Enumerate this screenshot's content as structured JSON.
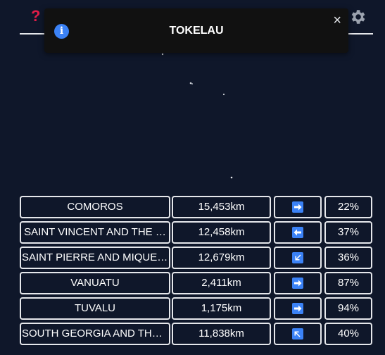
{
  "header": {
    "help_icon": "question-mark-icon",
    "settings_icon": "gear-icon"
  },
  "toast": {
    "icon": "info-icon",
    "title": "TOKELAU",
    "close_label": "×"
  },
  "guesses": [
    {
      "country": "COMOROS",
      "distance": "15,453km",
      "direction": "E",
      "direction_icon": "arrow-right-icon",
      "proximity": "22%"
    },
    {
      "country": "SAINT VINCENT AND THE …",
      "distance": "12,458km",
      "direction": "W",
      "direction_icon": "arrow-left-icon",
      "proximity": "37%"
    },
    {
      "country": "SAINT PIERRE AND MIQUEL…",
      "distance": "12,679km",
      "direction": "SW",
      "direction_icon": "arrow-down-left-icon",
      "proximity": "36%"
    },
    {
      "country": "VANUATU",
      "distance": "2,411km",
      "direction": "E",
      "direction_icon": "arrow-right-icon",
      "proximity": "87%"
    },
    {
      "country": "TUVALU",
      "distance": "1,175km",
      "direction": "E",
      "direction_icon": "arrow-right-icon",
      "proximity": "94%"
    },
    {
      "country": "SOUTH GEORGIA AND THE …",
      "distance": "11,838km",
      "direction": "NW",
      "direction_icon": "arrow-up-left-icon",
      "proximity": "40%"
    }
  ],
  "colors": {
    "background": "#0f172a",
    "help_icon": "#e11d48",
    "arrow_tile": "#3b82f6",
    "toast_bg": "#111111"
  }
}
